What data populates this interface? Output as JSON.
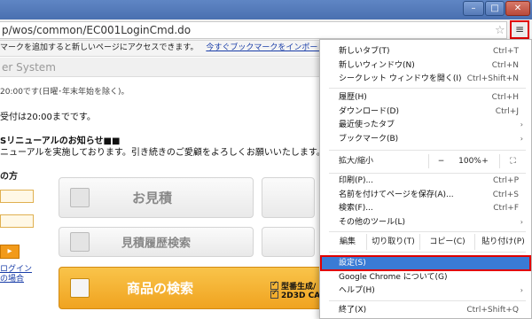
{
  "window": {
    "min": "–",
    "max": "□",
    "close": "✕"
  },
  "browser": {
    "url": "p/wos/common/EC001LoginCmd.do",
    "menu_icon": "≡",
    "star_icon": "☆",
    "bookmark_bar_text": "マークを追加すると新しいページにアクセスできます。",
    "bookmark_bar_link": "今すぐブックマークをインポート..."
  },
  "page": {
    "header": "er System",
    "hours": "20:00です(日曜･年末年始を除く)。",
    "notice1": "受付は20:00までです。",
    "notice2": "Sリニューアルのお知らせ■■",
    "notice3": "ニューアルを実施しております。引き続きのご愛顧をよろしくお願いいたします。",
    "section": "の方",
    "login_arrow": "▸",
    "login_link1": "ログイン",
    "login_link2": "の場合",
    "tiles": {
      "quote": "お見積",
      "quote_history": "見積履歴検索",
      "product_search": "商品の検索"
    },
    "checks": [
      "型番生成/",
      "2D3D CA"
    ]
  },
  "menu": {
    "new_tab": {
      "label": "新しいタブ(T)",
      "shortcut": "Ctrl+T"
    },
    "new_window": {
      "label": "新しいウィンドウ(N)",
      "shortcut": "Ctrl+N"
    },
    "incognito": {
      "label": "シークレット ウィンドウを開く(I)",
      "shortcut": "Ctrl+Shift+N"
    },
    "history": {
      "label": "履歴(H)",
      "shortcut": "Ctrl+H"
    },
    "downloads": {
      "label": "ダウンロード(D)",
      "shortcut": "Ctrl+J"
    },
    "recent_tabs": {
      "label": "最近使ったタブ"
    },
    "bookmarks": {
      "label": "ブックマーク(B)"
    },
    "zoom": {
      "label": "拡大/縮小",
      "minus": "−",
      "value": "100%",
      "plus": "+",
      "fullscreen": "⛶"
    },
    "print": {
      "label": "印刷(P)...",
      "shortcut": "Ctrl+P"
    },
    "save_as": {
      "label": "名前を付けてページを保存(A)...",
      "shortcut": "Ctrl+S"
    },
    "find": {
      "label": "検索(F)...",
      "shortcut": "Ctrl+F"
    },
    "more_tools": {
      "label": "その他のツール(L)"
    },
    "edit": {
      "label": "編集",
      "cut": "切り取り(T)",
      "copy": "コピー(C)",
      "paste": "貼り付け(P)"
    },
    "settings": {
      "label": "設定(S)"
    },
    "about": {
      "label": "Google Chrome について(G)"
    },
    "help": {
      "label": "ヘルプ(H)"
    },
    "exit": {
      "label": "終了(X)",
      "shortcut": "Ctrl+Shift+Q"
    },
    "submenu_arrow": "›"
  },
  "colors": {
    "highlight": "#3a7bd5",
    "callout": "#e00000",
    "orange_tile": "#f0a320"
  }
}
